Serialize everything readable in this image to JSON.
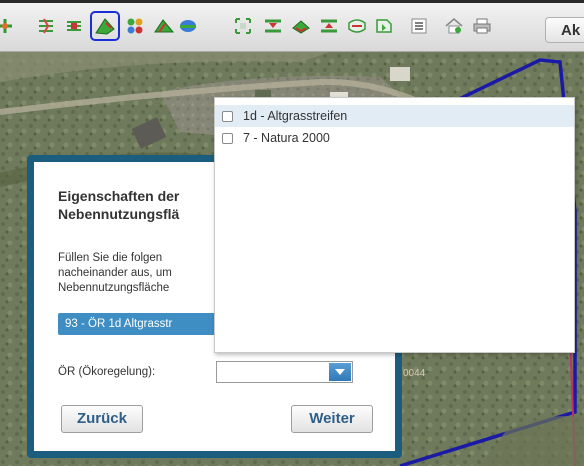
{
  "toolbar": {
    "icons": [
      "draw-point-icon",
      "draw-line-icon",
      "edit-line-icon",
      "draw-polygon-icon",
      "select-polygon-icon",
      "split-polygon-icon",
      "measure-area-icon",
      "zoom-extent-icon",
      "layer-down-icon",
      "layer-up-icon",
      "layer-merge-icon",
      "layer-edit-icon",
      "layer-copy-icon",
      "list-icon",
      "home-icon",
      "print-icon"
    ],
    "selected_icon": "draw-polygon-icon",
    "ak_label": "Ak"
  },
  "dialog": {
    "title_line1": "Eigenschaften der",
    "title_line2": "Nebennutzungsflä",
    "text_line1": "Füllen Sie die folgen",
    "text_line2": "nacheinander aus, um",
    "text_line3": "Nebennutzungsfläche",
    "selected_value": "93 - ÖR 1d Altgrasstr",
    "or_label": "ÖR (Ökoregelung):",
    "or_value": "",
    "back_label": "Zurück",
    "next_label": "Weiter"
  },
  "dropdown": {
    "options": [
      {
        "label": "1d - Altgrasstreifen",
        "checked": false
      },
      {
        "label": "7 - Natura 2000",
        "checked": false
      }
    ]
  },
  "map": {
    "parcel_label": "0044"
  },
  "colors": {
    "dialog_border": "#1c5d7f",
    "selected_bar": "#3e8ec4",
    "parcel_outline": "#1a1aa6",
    "dropdown_highlight": "#e2ecf5"
  }
}
